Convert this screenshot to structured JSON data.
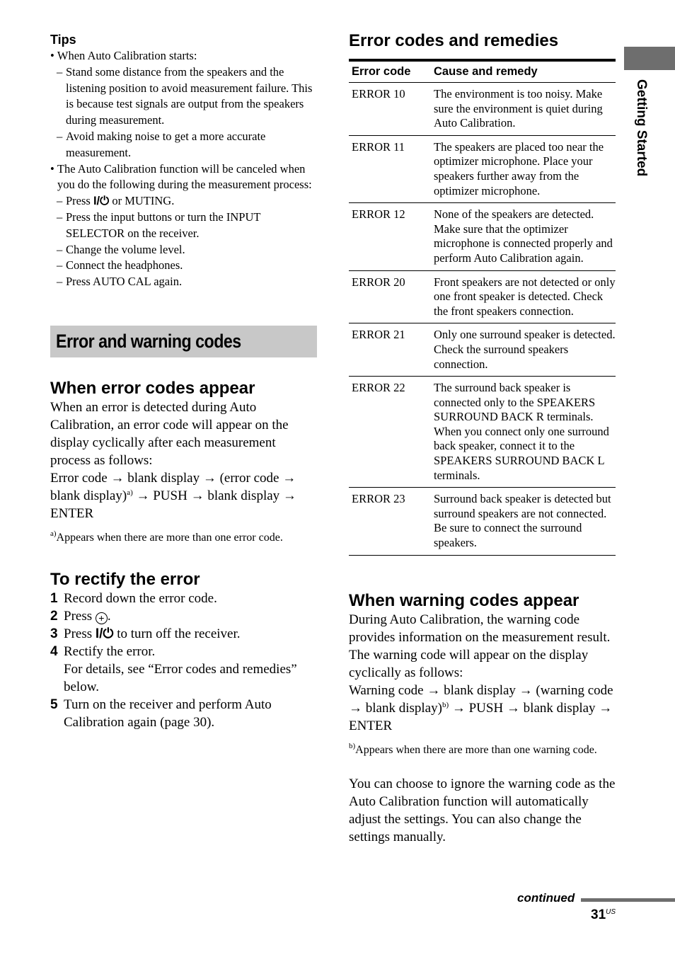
{
  "tips": {
    "title": "Tips",
    "items": [
      {
        "type": "bullet",
        "text": "When Auto Calibration starts:"
      },
      {
        "type": "dash",
        "text": "Stand some distance from the speakers and the listening position to avoid measurement failure. This is because test signals are output from the speakers during measurement."
      },
      {
        "type": "dash",
        "text": "Avoid making noise to get a more accurate measurement."
      },
      {
        "type": "bullet",
        "text": "The Auto Calibration function will be canceled when you do the following during the measurement process:"
      },
      {
        "type": "dash",
        "text": "Press ⏻ or MUTING.",
        "pre": "Press ",
        "post": " or MUTING."
      },
      {
        "type": "dash",
        "text": "Press the input buttons or turn the INPUT SELECTOR on the receiver."
      },
      {
        "type": "dash",
        "text": "Change the volume level."
      },
      {
        "type": "dash",
        "text": "Connect the headphones."
      },
      {
        "type": "dash",
        "text": "Press AUTO CAL again."
      }
    ],
    "bullet_char": "•",
    "dash_char": "–"
  },
  "section_band": {
    "title": "Error and warning codes",
    "color": "#c8c8c8"
  },
  "error_appear": {
    "heading": "When error codes appear",
    "body": "When an error is detected during Auto Calibration, an error code will appear on the display cyclically after each measurement process as follows:",
    "sequence": [
      "Error code",
      "→",
      "blank display",
      "→",
      "(error code",
      "→",
      "blank display)",
      "a)",
      "→",
      "PUSH",
      "→",
      "blank display",
      "→",
      "ENTER"
    ],
    "footnote_mark": "a)",
    "footnote": "Appears when there are more than one error code."
  },
  "rectify": {
    "heading": "To rectify the error",
    "steps": [
      {
        "n": "1",
        "text": "Record down the error code."
      },
      {
        "n": "2",
        "pre": "Press ",
        "icon": "+",
        "post": "."
      },
      {
        "n": "3",
        "pre": "Press ",
        "post": " to turn off the receiver."
      },
      {
        "n": "4",
        "text": "Rectify the error.",
        "sub": "For details, see “Error codes and remedies” below."
      },
      {
        "n": "5",
        "text": "Turn on the receiver and perform Auto Calibration again (page 30)."
      }
    ],
    "power_symbol": "I/⏻"
  },
  "error_table": {
    "title": "Error codes and remedies",
    "headers": [
      "Error code",
      "Cause and remedy"
    ],
    "rows": [
      {
        "code": "ERROR 10",
        "remedy": "The environment is too noisy. Make sure the environment is quiet during Auto Calibration."
      },
      {
        "code": "ERROR 11",
        "remedy": "The speakers are placed too near the optimizer microphone. Place your speakers further away from the optimizer microphone."
      },
      {
        "code": "ERROR 12",
        "remedy": "None of the speakers are detected. Make sure that the optimizer microphone is connected properly and perform Auto Calibration again."
      },
      {
        "code": "ERROR 20",
        "remedy": "Front speakers are not detected or only one front speaker is detected. Check the front speakers connection."
      },
      {
        "code": "ERROR 21",
        "remedy": "Only one surround speaker is detected. Check the surround speakers connection."
      },
      {
        "code": "ERROR 22",
        "remedy": "The surround back speaker is connected only to the SPEAKERS SURROUND BACK R terminals. When you connect only one surround back speaker, connect it to the SPEAKERS SURROUND BACK L terminals."
      },
      {
        "code": "ERROR 23",
        "remedy": "Surround back speaker is detected but surround speakers are not connected. Be sure to connect the surround speakers."
      }
    ]
  },
  "warning_appear": {
    "heading": "When warning codes appear",
    "body": "During Auto Calibration, the warning code provides information on the measurement result. The warning code will appear on the display cyclically as follows:",
    "seq_pre": "Warning code → blank display → (warning code → blank display)",
    "seq_mark": "b)",
    "seq_post": " → PUSH → blank display → ENTER",
    "footnote_mark": "b)",
    "footnote": "Appears when there are more than one warning code.",
    "note": "You can choose to ignore the warning code as the Auto Calibration function will automatically adjust the settings. You can also change the settings manually."
  },
  "footer": {
    "continued": "continued",
    "page_number": "31",
    "page_suffix": "US"
  },
  "side_tab": {
    "label": "Getting Started",
    "color": "#6e6e6e"
  }
}
